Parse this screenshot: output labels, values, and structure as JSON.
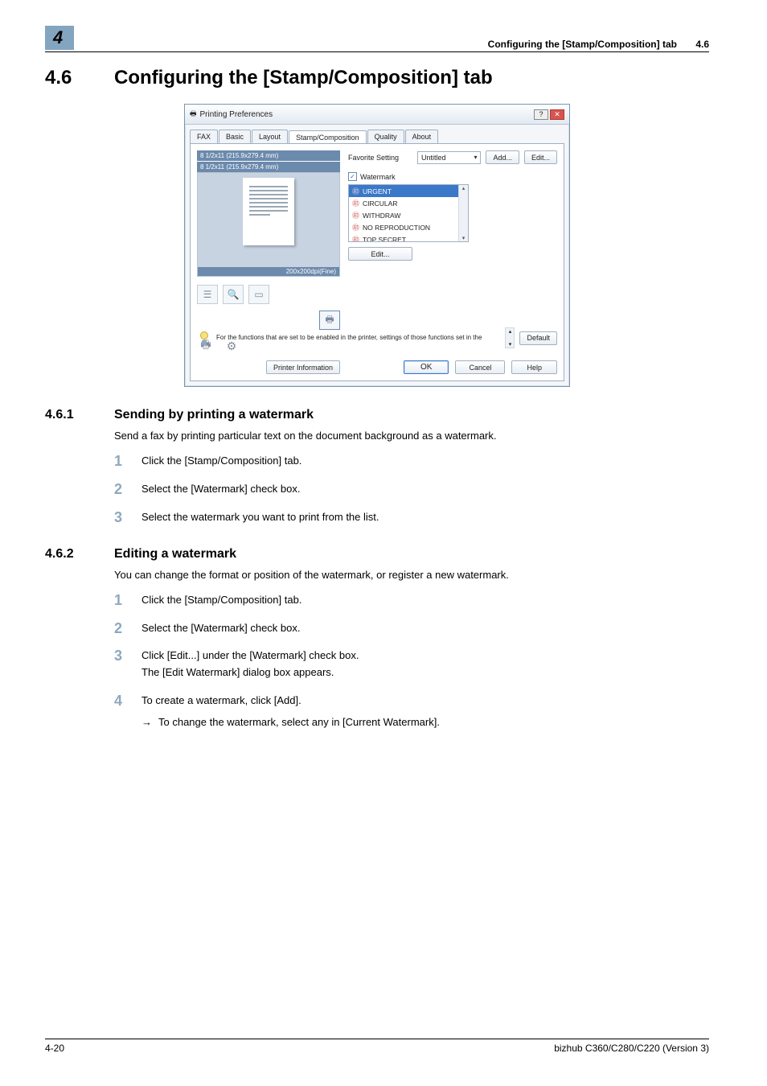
{
  "header": {
    "chapter": "4",
    "title": "Configuring the [Stamp/Composition] tab",
    "section_no": "4.6"
  },
  "h1": {
    "num": "4.6",
    "text": "Configuring the [Stamp/Composition] tab"
  },
  "dialog": {
    "title": "Printing Preferences",
    "tabs": [
      "FAX",
      "Basic",
      "Layout",
      "Stamp/Composition",
      "Quality",
      "About"
    ],
    "active_tab": "Stamp/Composition",
    "paper_top": "8 1/2x11 (215.9x279.4 mm)",
    "paper_bottom": "8 1/2x11 (215.9x279.4 mm)",
    "dpi": "200x200dpi(Fine)",
    "printer_info_btn": "Printer Information",
    "fav_label": "Favorite Setting",
    "fav_value": "Untitled",
    "add_btn": "Add...",
    "edit_btn": "Edit...",
    "watermark_chk": "Watermark",
    "wm_items": [
      "URGENT",
      "CIRCULAR",
      "WITHDRAW",
      "NO REPRODUCTION",
      "TOP SECRET"
    ],
    "wm_edit_btn": "Edit...",
    "hint": "For the functions that are set to be enabled in the printer, settings of those functions set in the",
    "default_btn": "Default",
    "ok_btn": "OK",
    "cancel_btn": "Cancel",
    "help_btn": "Help"
  },
  "s461": {
    "num": "4.6.1",
    "title": "Sending by printing a watermark",
    "intro": "Send a fax by printing particular text on the document background as a watermark.",
    "steps": [
      "Click the [Stamp/Composition] tab.",
      "Select the [Watermark] check box.",
      "Select the watermark you want to print from the list."
    ]
  },
  "s462": {
    "num": "4.6.2",
    "title": "Editing a watermark",
    "intro": "You can change the format or position of the watermark, or register a new watermark.",
    "step1": "Click the [Stamp/Composition] tab.",
    "step2": "Select the [Watermark] check box.",
    "step3a": "Click [Edit...] under the [Watermark] check box.",
    "step3b": "The [Edit Watermark] dialog box appears.",
    "step4a": "To create a watermark, click [Add].",
    "step4b": "To change the watermark, select any in [Current Watermark]."
  },
  "footer": {
    "page": "4-20",
    "product": "bizhub C360/C280/C220 (Version 3)"
  }
}
